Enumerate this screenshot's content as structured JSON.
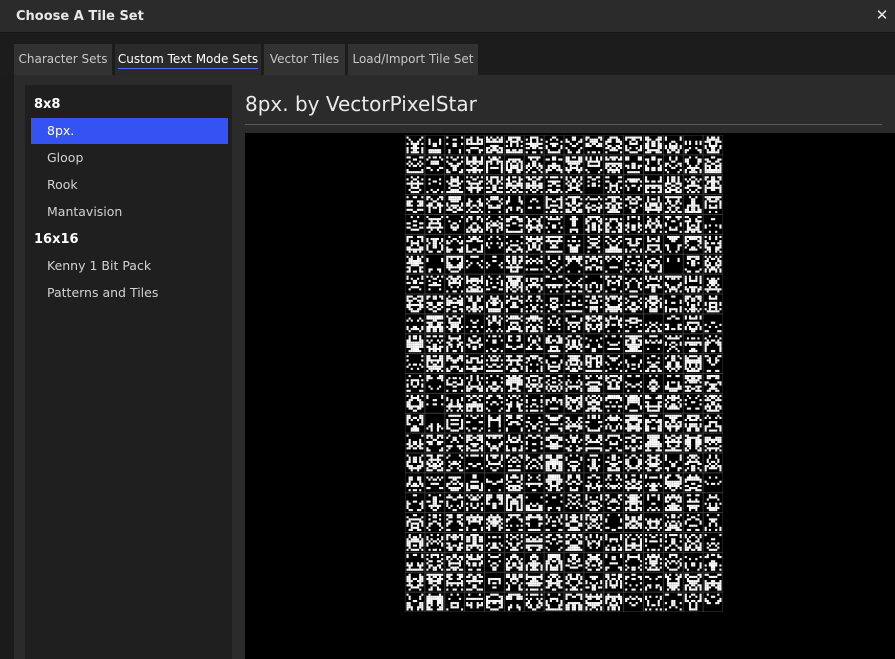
{
  "window": {
    "title": "Choose A Tile Set"
  },
  "tabs": [
    {
      "label": "Character Sets",
      "active": false
    },
    {
      "label": "Custom Text Mode Sets",
      "active": true
    },
    {
      "label": "Vector Tiles",
      "active": false
    },
    {
      "label": "Load/Import Tile Set",
      "active": false
    }
  ],
  "sidebar": {
    "groups": [
      {
        "heading": "8x8",
        "items": [
          "8px.",
          "Gloop",
          "Rook",
          "Mantavision"
        ]
      },
      {
        "heading": "16x16",
        "items": [
          "Kenny 1 Bit Pack",
          "Patterns and Tiles"
        ]
      }
    ],
    "selected": "8px."
  },
  "main": {
    "title": "8px. by VectorPixelStar"
  },
  "tileset_preview": {
    "columns": 16,
    "rows": 24
  },
  "colors": {
    "accent": "#3552f2",
    "background": "#1b1b1b",
    "panel": "#2b2b2b"
  },
  "icons": {
    "close": "close-icon"
  }
}
